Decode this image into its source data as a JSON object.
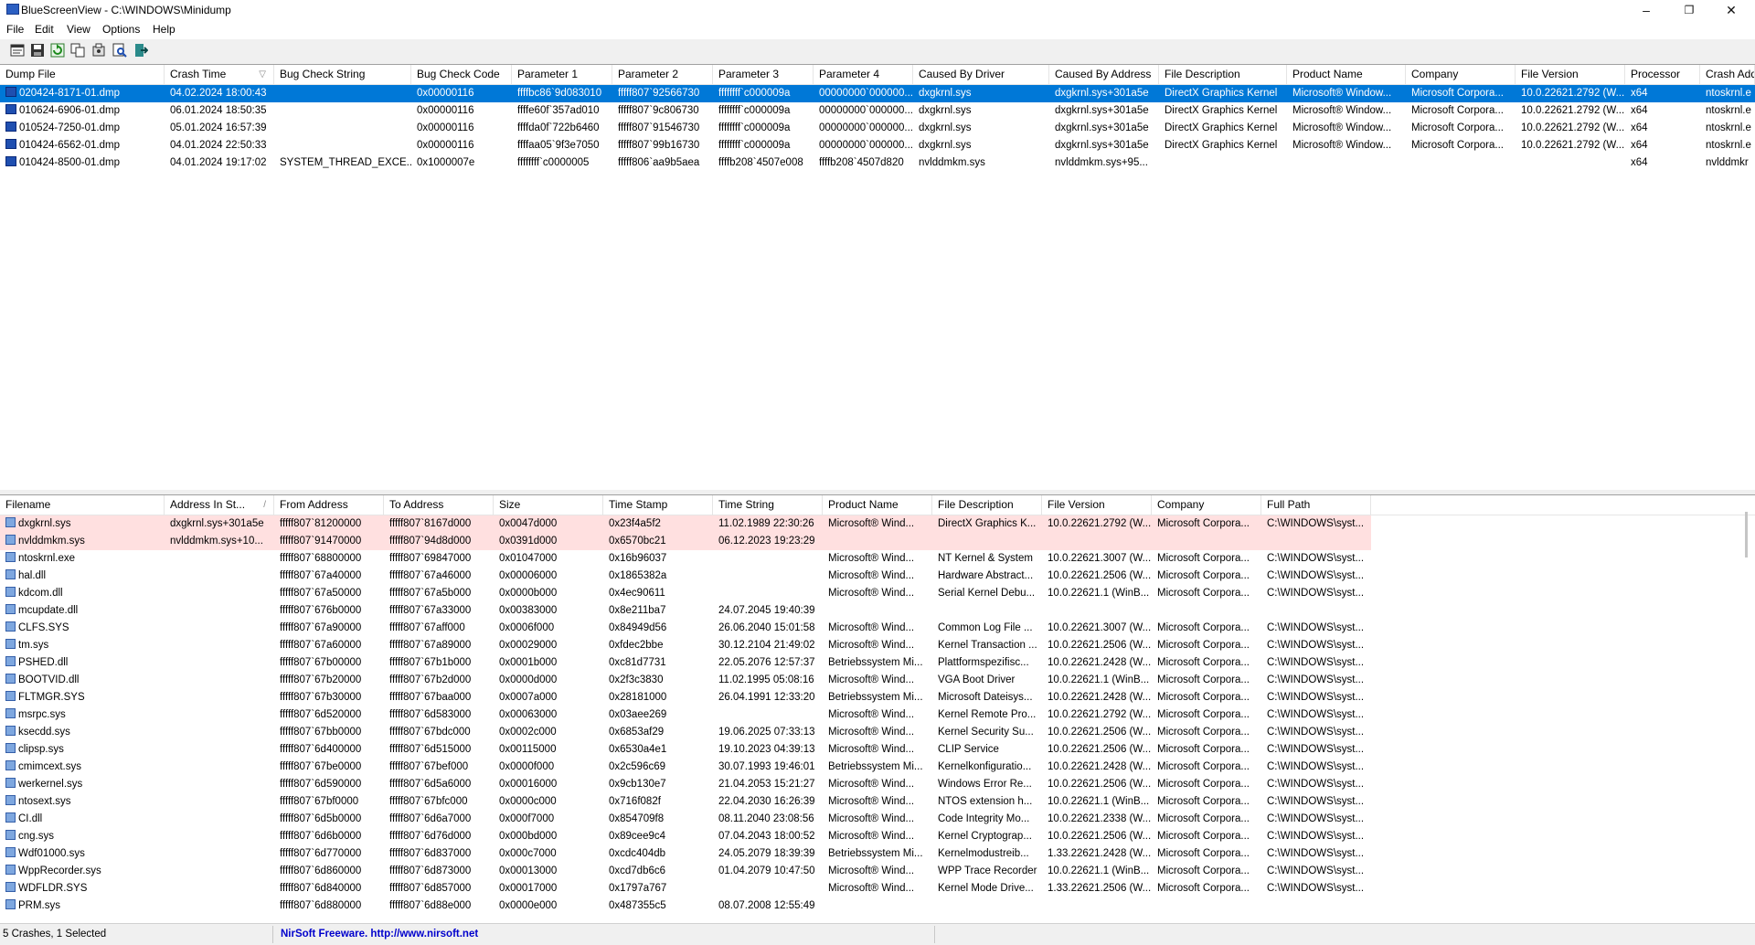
{
  "window": {
    "title": "BlueScreenView  -  C:\\WINDOWS\\Minidump",
    "minimize": "–",
    "maximize": "❐",
    "close": "✕"
  },
  "menu": [
    "File",
    "Edit",
    "View",
    "Options",
    "Help"
  ],
  "toolbar": [
    "properties-icon",
    "save-icon",
    "refresh-icon",
    "copy-icon",
    "advanced-options-icon",
    "find-icon",
    "exit-icon"
  ],
  "colors": {
    "selection": "#0078d7",
    "highlight": "#ffe0e0",
    "link": "#0000cc"
  },
  "crashes": {
    "columns": [
      "Dump File",
      "Crash Time",
      "Bug Check String",
      "Bug Check Code",
      "Parameter 1",
      "Parameter 2",
      "Parameter 3",
      "Parameter 4",
      "Caused By Driver",
      "Caused By Address",
      "File Description",
      "Product Name",
      "Company",
      "File Version",
      "Processor",
      "Crash Add"
    ],
    "sort_indicator": "▽",
    "rows": [
      [
        "020424-8171-01.dmp",
        "04.02.2024 18:00:43",
        "",
        "0x00000116",
        "ffffbc86`9d083010",
        "fffff807`92566730",
        "ffffffff`c000009a",
        "00000000`000000...",
        "dxgkrnl.sys",
        "dxgkrnl.sys+301a5e",
        "DirectX Graphics Kernel",
        "Microsoft® Window...",
        "Microsoft Corpora...",
        "10.0.22621.2792 (W...",
        "x64",
        "ntoskrnl.e"
      ],
      [
        "010624-6906-01.dmp",
        "06.01.2024 18:50:35",
        "",
        "0x00000116",
        "ffffe60f`357ad010",
        "fffff807`9c806730",
        "ffffffff`c000009a",
        "00000000`000000...",
        "dxgkrnl.sys",
        "dxgkrnl.sys+301a5e",
        "DirectX Graphics Kernel",
        "Microsoft® Window...",
        "Microsoft Corpora...",
        "10.0.22621.2792 (W...",
        "x64",
        "ntoskrnl.e"
      ],
      [
        "010524-7250-01.dmp",
        "05.01.2024 16:57:39",
        "",
        "0x00000116",
        "ffffda0f`722b6460",
        "fffff807`91546730",
        "ffffffff`c000009a",
        "00000000`000000...",
        "dxgkrnl.sys",
        "dxgkrnl.sys+301a5e",
        "DirectX Graphics Kernel",
        "Microsoft® Window...",
        "Microsoft Corpora...",
        "10.0.22621.2792 (W...",
        "x64",
        "ntoskrnl.e"
      ],
      [
        "010424-6562-01.dmp",
        "04.01.2024 22:50:33",
        "",
        "0x00000116",
        "ffffaa05`9f3e7050",
        "fffff807`99b16730",
        "ffffffff`c000009a",
        "00000000`000000...",
        "dxgkrnl.sys",
        "dxgkrnl.sys+301a5e",
        "DirectX Graphics Kernel",
        "Microsoft® Window...",
        "Microsoft Corpora...",
        "10.0.22621.2792 (W...",
        "x64",
        "ntoskrnl.e"
      ],
      [
        "010424-8500-01.dmp",
        "04.01.2024 19:17:02",
        "SYSTEM_THREAD_EXCE...",
        "0x1000007e",
        "ffffffff`c0000005",
        "fffff806`aa9b5aea",
        "ffffb208`4507e008",
        "ffffb208`4507d820",
        "nvlddmkm.sys",
        "nvlddmkm.sys+95...",
        "",
        "",
        "",
        "",
        "x64",
        "nvlddmkr"
      ]
    ]
  },
  "drivers": {
    "columns": [
      "Filename",
      "Address In St...",
      "From Address",
      "To Address",
      "Size",
      "Time Stamp",
      "Time String",
      "Product Name",
      "File Description",
      "File Version",
      "Company",
      "Full Path"
    ],
    "sort_indicator": "/",
    "rows": [
      [
        "dxgkrnl.sys",
        "dxgkrnl.sys+301a5e",
        "fffff807`81200000",
        "fffff807`8167d000",
        "0x0047d000",
        "0x23f4a5f2",
        "11.02.1989 22:30:26",
        "Microsoft® Wind...",
        "DirectX Graphics K...",
        "10.0.22621.2792 (W...",
        "Microsoft Corpora...",
        "C:\\WINDOWS\\syst..."
      ],
      [
        "nvlddmkm.sys",
        "nvlddmkm.sys+10...",
        "fffff807`91470000",
        "fffff807`94d8d000",
        "0x0391d000",
        "0x6570bc21",
        "06.12.2023 19:23:29",
        "",
        "",
        "",
        "",
        ""
      ],
      [
        "ntoskrnl.exe",
        "",
        "fffff807`68800000",
        "fffff807`69847000",
        "0x01047000",
        "0x16b96037",
        "",
        "Microsoft® Wind...",
        "NT Kernel & System",
        "10.0.22621.3007 (W...",
        "Microsoft Corpora...",
        "C:\\WINDOWS\\syst..."
      ],
      [
        "hal.dll",
        "",
        "fffff807`67a40000",
        "fffff807`67a46000",
        "0x00006000",
        "0x1865382a",
        "",
        "Microsoft® Wind...",
        "Hardware Abstract...",
        "10.0.22621.2506 (W...",
        "Microsoft Corpora...",
        "C:\\WINDOWS\\syst..."
      ],
      [
        "kdcom.dll",
        "",
        "fffff807`67a50000",
        "fffff807`67a5b000",
        "0x0000b000",
        "0x4ec90611",
        "",
        "Microsoft® Wind...",
        "Serial Kernel Debu...",
        "10.0.22621.1 (WinB...",
        "Microsoft Corpora...",
        "C:\\WINDOWS\\syst..."
      ],
      [
        "mcupdate.dll",
        "",
        "fffff807`676b0000",
        "fffff807`67a33000",
        "0x00383000",
        "0x8e211ba7",
        "24.07.2045 19:40:39",
        "",
        "",
        "",
        "",
        ""
      ],
      [
        "CLFS.SYS",
        "",
        "fffff807`67a90000",
        "fffff807`67aff000",
        "0x0006f000",
        "0x84949d56",
        "26.06.2040 15:01:58",
        "Microsoft® Wind...",
        "Common Log File ...",
        "10.0.22621.3007 (W...",
        "Microsoft Corpora...",
        "C:\\WINDOWS\\syst..."
      ],
      [
        "tm.sys",
        "",
        "fffff807`67a60000",
        "fffff807`67a89000",
        "0x00029000",
        "0xfdec2bbe",
        "30.12.2104 21:49:02",
        "Microsoft® Wind...",
        "Kernel Transaction ...",
        "10.0.22621.2506 (W...",
        "Microsoft Corpora...",
        "C:\\WINDOWS\\syst..."
      ],
      [
        "PSHED.dll",
        "",
        "fffff807`67b00000",
        "fffff807`67b1b000",
        "0x0001b000",
        "0xc81d7731",
        "22.05.2076 12:57:37",
        "Betriebssystem Mi...",
        "Plattformspezifisc...",
        "10.0.22621.2428 (W...",
        "Microsoft Corpora...",
        "C:\\WINDOWS\\syst..."
      ],
      [
        "BOOTVID.dll",
        "",
        "fffff807`67b20000",
        "fffff807`67b2d000",
        "0x0000d000",
        "0x2f3c3830",
        "11.02.1995 05:08:16",
        "Microsoft® Wind...",
        "VGA Boot Driver",
        "10.0.22621.1 (WinB...",
        "Microsoft Corpora...",
        "C:\\WINDOWS\\syst..."
      ],
      [
        "FLTMGR.SYS",
        "",
        "fffff807`67b30000",
        "fffff807`67baa000",
        "0x0007a000",
        "0x28181000",
        "26.04.1991 12:33:20",
        "Betriebssystem Mi...",
        "Microsoft Dateisys...",
        "10.0.22621.2428 (W...",
        "Microsoft Corpora...",
        "C:\\WINDOWS\\syst..."
      ],
      [
        "msrpc.sys",
        "",
        "fffff807`6d520000",
        "fffff807`6d583000",
        "0x00063000",
        "0x03aee269",
        "",
        "Microsoft® Wind...",
        "Kernel Remote Pro...",
        "10.0.22621.2792 (W...",
        "Microsoft Corpora...",
        "C:\\WINDOWS\\syst..."
      ],
      [
        "ksecdd.sys",
        "",
        "fffff807`67bb0000",
        "fffff807`67bdc000",
        "0x0002c000",
        "0x6853af29",
        "19.06.2025 07:33:13",
        "Microsoft® Wind...",
        "Kernel Security Su...",
        "10.0.22621.2506 (W...",
        "Microsoft Corpora...",
        "C:\\WINDOWS\\syst..."
      ],
      [
        "clipsp.sys",
        "",
        "fffff807`6d400000",
        "fffff807`6d515000",
        "0x00115000",
        "0x6530a4e1",
        "19.10.2023 04:39:13",
        "Microsoft® Wind...",
        "CLIP Service",
        "10.0.22621.2506 (W...",
        "Microsoft Corpora...",
        "C:\\WINDOWS\\syst..."
      ],
      [
        "cmimcext.sys",
        "",
        "fffff807`67be0000",
        "fffff807`67bef000",
        "0x0000f000",
        "0x2c596c69",
        "30.07.1993 19:46:01",
        "Betriebssystem Mi...",
        "Kernelkonfiguratio...",
        "10.0.22621.2428 (W...",
        "Microsoft Corpora...",
        "C:\\WINDOWS\\syst..."
      ],
      [
        "werkernel.sys",
        "",
        "fffff807`6d590000",
        "fffff807`6d5a6000",
        "0x00016000",
        "0x9cb130e7",
        "21.04.2053 15:21:27",
        "Microsoft® Wind...",
        "Windows Error Re...",
        "10.0.22621.2506 (W...",
        "Microsoft Corpora...",
        "C:\\WINDOWS\\syst..."
      ],
      [
        "ntosext.sys",
        "",
        "fffff807`67bf0000",
        "fffff807`67bfc000",
        "0x0000c000",
        "0x716f082f",
        "22.04.2030 16:26:39",
        "Microsoft® Wind...",
        "NTOS extension h...",
        "10.0.22621.1 (WinB...",
        "Microsoft Corpora...",
        "C:\\WINDOWS\\syst..."
      ],
      [
        "CI.dll",
        "",
        "fffff807`6d5b0000",
        "fffff807`6d6a7000",
        "0x000f7000",
        "0x854709f8",
        "08.11.2040 23:08:56",
        "Microsoft® Wind...",
        "Code Integrity Mo...",
        "10.0.22621.2338 (W...",
        "Microsoft Corpora...",
        "C:\\WINDOWS\\syst..."
      ],
      [
        "cng.sys",
        "",
        "fffff807`6d6b0000",
        "fffff807`6d76d000",
        "0x000bd000",
        "0x89cee9c4",
        "07.04.2043 18:00:52",
        "Microsoft® Wind...",
        "Kernel Cryptograp...",
        "10.0.22621.2506 (W...",
        "Microsoft Corpora...",
        "C:\\WINDOWS\\syst..."
      ],
      [
        "Wdf01000.sys",
        "",
        "fffff807`6d770000",
        "fffff807`6d837000",
        "0x000c7000",
        "0xcdc404db",
        "24.05.2079 18:39:39",
        "Betriebssystem Mi...",
        "Kernelmodustreib...",
        "1.33.22621.2428 (W...",
        "Microsoft Corpora...",
        "C:\\WINDOWS\\syst..."
      ],
      [
        "WppRecorder.sys",
        "",
        "fffff807`6d860000",
        "fffff807`6d873000",
        "0x00013000",
        "0xcd7db6c6",
        "01.04.2079 10:47:50",
        "Microsoft® Wind...",
        "WPP Trace Recorder",
        "10.0.22621.1 (WinB...",
        "Microsoft Corpora...",
        "C:\\WINDOWS\\syst..."
      ],
      [
        "WDFLDR.SYS",
        "",
        "fffff807`6d840000",
        "fffff807`6d857000",
        "0x00017000",
        "0x1797a767",
        "",
        "Microsoft® Wind...",
        "Kernel Mode Drive...",
        "1.33.22621.2506 (W...",
        "Microsoft Corpora...",
        "C:\\WINDOWS\\syst..."
      ],
      [
        "PRM.sys",
        "",
        "fffff807`6d880000",
        "fffff807`6d88e000",
        "0x0000e000",
        "0x487355c5",
        "08.07.2008 12:55:49",
        "",
        "",
        "",
        "",
        ""
      ]
    ]
  },
  "status": {
    "count": "5 Crashes, 1 Selected",
    "credit": "NirSoft Freeware.  http://www.nirsoft.net"
  }
}
